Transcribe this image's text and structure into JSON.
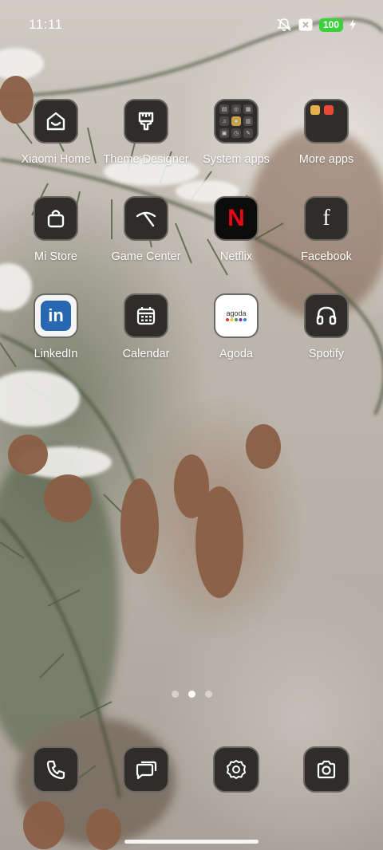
{
  "status_bar": {
    "time": "11:11",
    "battery_level": "100",
    "icons": [
      "mute-icon",
      "sim-x-icon",
      "battery-icon",
      "charging-icon"
    ]
  },
  "apps": [
    {
      "label": "Xiaomi Home",
      "icon": "xiaomi-home-icon"
    },
    {
      "label": "Theme Designer",
      "icon": "theme-brush-icon"
    },
    {
      "label": "System apps",
      "icon": "folder-icon"
    },
    {
      "label": "More apps",
      "icon": "folder-icon"
    },
    {
      "label": "Mi Store",
      "icon": "shopping-bag-icon"
    },
    {
      "label": "Game Center",
      "icon": "game-center-icon"
    },
    {
      "label": "Netflix",
      "icon": "netflix-icon",
      "glyph": "N"
    },
    {
      "label": "Facebook",
      "icon": "facebook-icon",
      "glyph": "f"
    },
    {
      "label": "LinkedIn",
      "icon": "linkedin-icon",
      "glyph": "in"
    },
    {
      "label": "Calendar",
      "icon": "calendar-icon"
    },
    {
      "label": "Agoda",
      "icon": "agoda-icon",
      "glyph": "agoda"
    },
    {
      "label": "Spotify",
      "icon": "headphones-icon"
    }
  ],
  "pager": {
    "pages": 3,
    "current": 2
  },
  "dock": [
    {
      "icon": "phone-icon"
    },
    {
      "icon": "messages-icon"
    },
    {
      "icon": "settings-gear-icon"
    },
    {
      "icon": "camera-icon"
    }
  ],
  "colors": {
    "icon_bg": "#2f2d2a",
    "icon_border": "#6b6863",
    "netflix_red": "#e50914",
    "linkedin_blue": "#2867b2",
    "battery_green": "#3bd13b"
  }
}
